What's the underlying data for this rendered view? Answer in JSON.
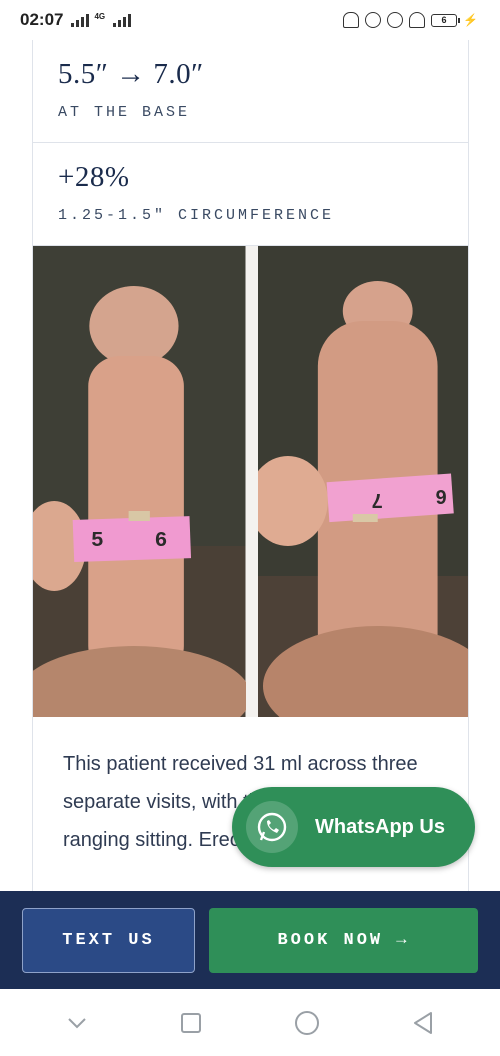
{
  "status_bar": {
    "time": "02:07",
    "network_tag": "4G",
    "battery": "6"
  },
  "stats": [
    {
      "value": "5.5″ → 7.0″",
      "label": "AT THE BASE"
    },
    {
      "value": "+28%",
      "label": "1.25-1.5″ CIRCUMFERENCE"
    }
  ],
  "photos": {
    "left_tape_numbers": [
      "5",
      "6"
    ],
    "right_tape_numbers": [
      "7",
      "6"
    ]
  },
  "body": {
    "text": "This patient received 31 ml across three separate visits, with the result in stages ranging sitting. Erect circumference went"
  },
  "whatsapp": {
    "label": "WhatsApp Us"
  },
  "cta": {
    "text_us": "TEXT US",
    "book_now": "BOOK NOW →"
  },
  "nav": {
    "icons": [
      "chevron-down-icon",
      "recents-icon",
      "home-icon",
      "back-icon"
    ]
  },
  "colors": {
    "navy": "#1c2e55",
    "green": "#2f8f58",
    "text_us_bg": "#2b4a86"
  }
}
